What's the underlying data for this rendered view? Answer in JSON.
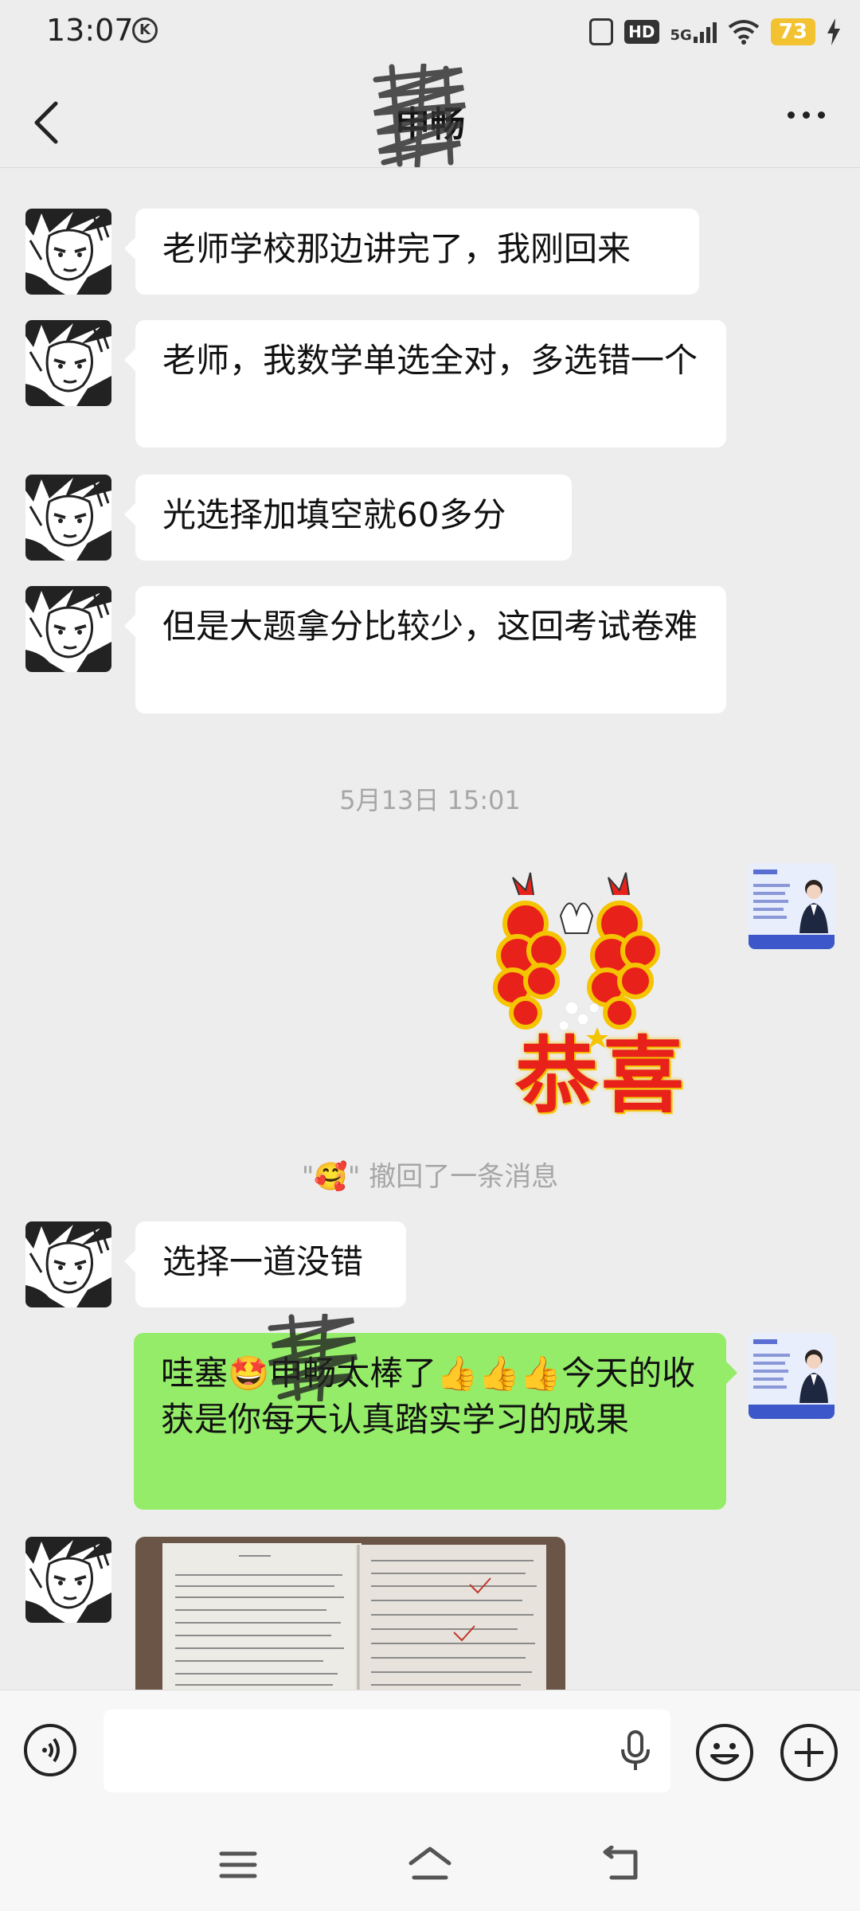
{
  "status_bar": {
    "time": "13:07",
    "k_badge": "K",
    "hd": "HD",
    "network": "5G",
    "battery": "73"
  },
  "header": {
    "title": "申畅",
    "back_icon": "chevron-left-icon",
    "more_icon": "more-dots-icon"
  },
  "messages": {
    "m1": "老师学校那边讲完了，我刚回来",
    "m2": "老师，我数学单选全对，多选错一个",
    "m3": "光选择加填空就60多分",
    "m4": "但是大题拿分比较少，这回考试卷难",
    "timestamp": "5月13日 15:01",
    "sticker_text": "恭喜",
    "recall_quote_open": "\"",
    "recall_emoji": "🥰",
    "recall_quote_close": "\"",
    "recall_text": " 撤回了一条消息",
    "m5": "选择一道没错",
    "m6": "哇塞🤩申畅太棒了👍👍👍今天的收获是你每天认真踏实学习的成果"
  },
  "colors": {
    "background": "#ededed",
    "outgoing_bubble": "#95ec69",
    "incoming_bubble": "#ffffff",
    "battery": "#f2c230",
    "sticker_red": "#e8221b",
    "sticker_yellow": "#f5c400"
  }
}
